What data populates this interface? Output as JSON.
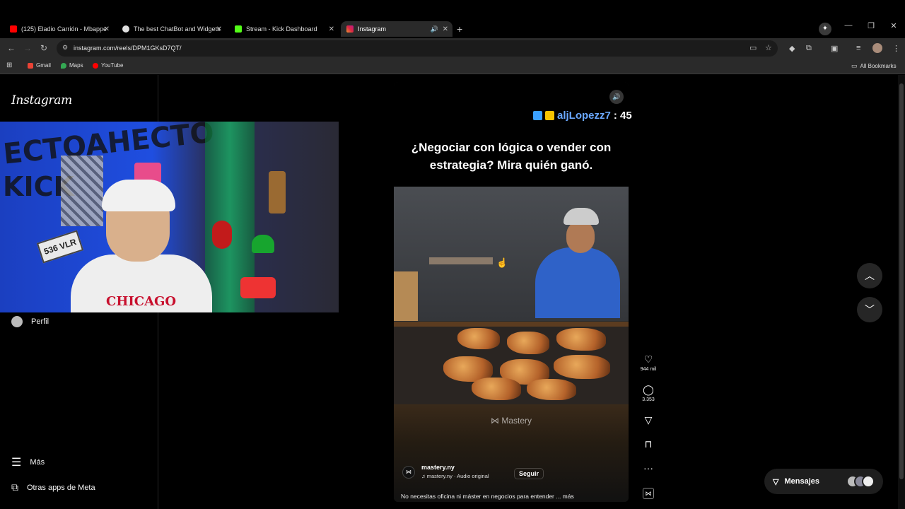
{
  "browser": {
    "tabs": [
      {
        "title": "(125) Eladio Carrión - Mbappe",
        "color": "#ff0000"
      },
      {
        "title": "The best ChatBot and Widgets",
        "color": "#e0e0e0"
      },
      {
        "title": "Stream - Kick Dashboard",
        "color": "#53fc18"
      },
      {
        "title": "Instagram",
        "color": "#e1306c",
        "active": true
      }
    ],
    "url": "instagram.com/reels/DPM1GKsD7QT/",
    "bookmarks": [
      {
        "label": "Gmail",
        "color": "#ea4335"
      },
      {
        "label": "Maps",
        "color": "#34a853"
      },
      {
        "label": "YouTube",
        "color": "#ff0000"
      }
    ],
    "all_bookmarks": "All Bookmarks"
  },
  "instagram": {
    "logo": "Instagram",
    "sidebar": {
      "profile": "Perfil",
      "more": "Más",
      "meta_apps": "Otras apps de Meta"
    },
    "reel": {
      "overlay_title": "¿Negociar con lógica o vender con estrategia? Mira quién ganó.",
      "watermark": "Mastery",
      "username": "mastery.ny",
      "audio": "mastery.ny · Audio original",
      "follow": "Seguir",
      "description": "No necesitas oficina ni máster en negocios para entender ... más"
    },
    "actions": {
      "likes": "944 mil",
      "comments": "3.353"
    },
    "messages": "Mensajes"
  },
  "chat_overlay": {
    "username": "aljLopezz7",
    "value": ": 45",
    "username_color": "#6aa8ff"
  }
}
